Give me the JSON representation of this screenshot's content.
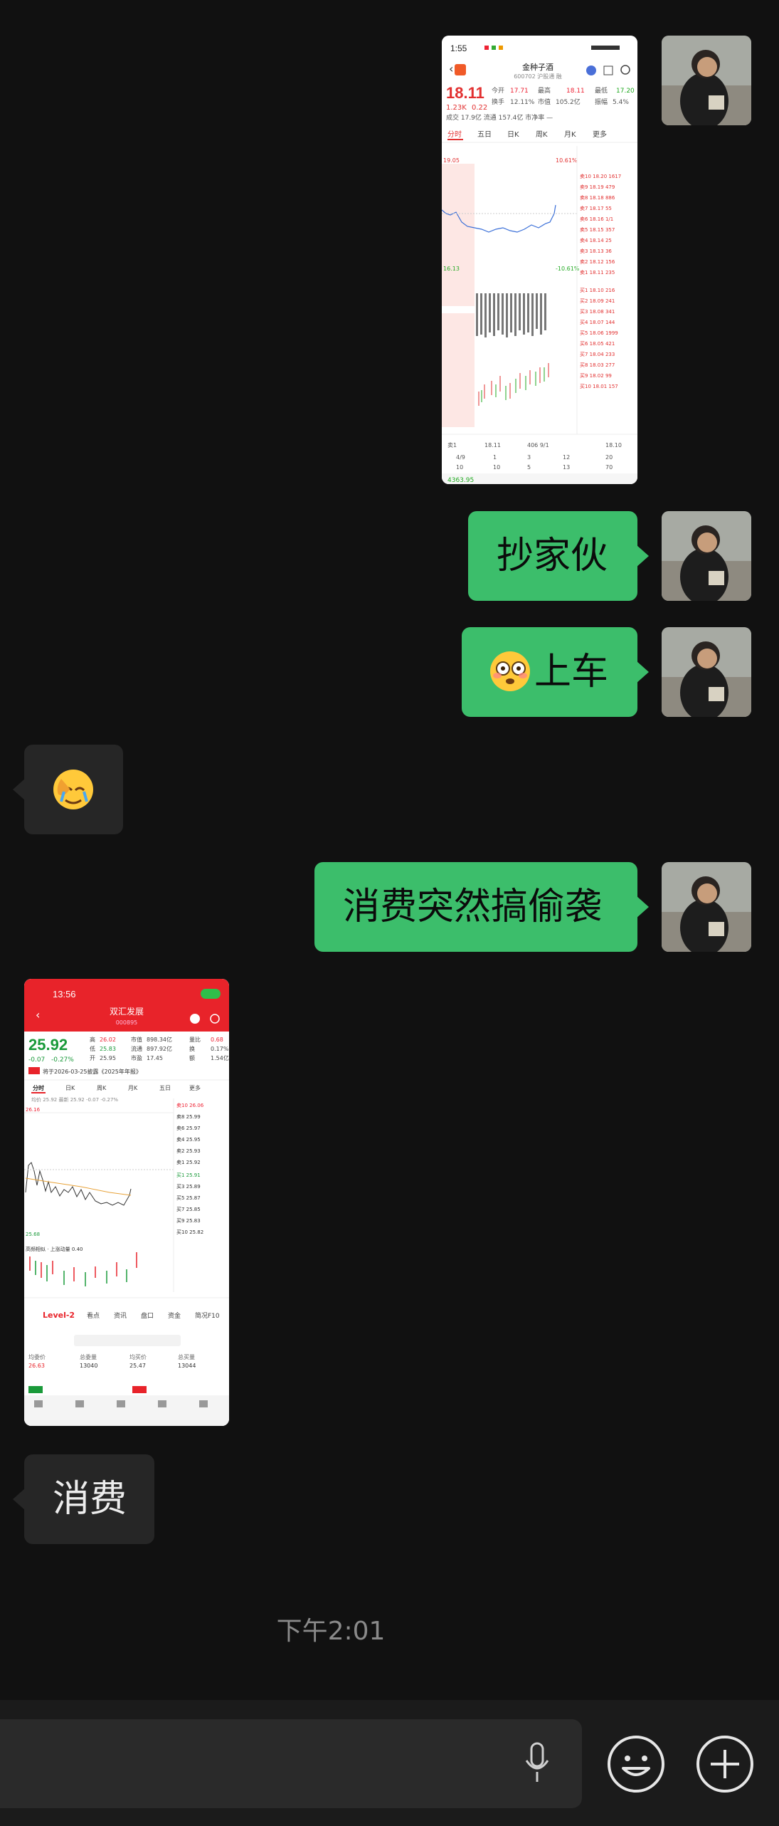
{
  "messages": {
    "m2": {
      "text": "抄家伙"
    },
    "m3": {
      "text": "上车"
    },
    "m5": {
      "text": "消费突然搞偷袭"
    },
    "m7": {
      "text": "消费"
    }
  },
  "timestamp": "下午2:01",
  "shot1": {
    "time": "1:55",
    "name": "金种子酒",
    "price": "18.11",
    "change": "1.23K",
    "pct": "0.22",
    "tabs": [
      "分时",
      "五日",
      "日K",
      "周K",
      "月K",
      "更多"
    ],
    "bottom_value": "4363.95"
  },
  "shot2": {
    "time": "13:56",
    "name": "双汇发展",
    "code": "000895",
    "price": "25.92",
    "change": "-0.07",
    "pct": "-0.27%",
    "notice": "将于2026-03-25披露《2025年年报》",
    "tabs": [
      "分时",
      "日K",
      "周K",
      "月K",
      "五日",
      "更多"
    ],
    "level": "Level-2",
    "subtabs": [
      "看点",
      "资讯",
      "盘口",
      "资金",
      "简况F10"
    ],
    "stats_labels": [
      "均委价",
      "总委量",
      "均买价",
      "总买量"
    ],
    "stats_values": [
      "26.63",
      "13040",
      "25.47",
      "13044"
    ]
  },
  "colors": {
    "bubble_out": "#3cbe6b",
    "bubble_in": "#262626",
    "background": "#111111"
  },
  "icons": {
    "voice": "microphone-icon",
    "emoji": "smiley-icon",
    "more": "plus-icon"
  }
}
